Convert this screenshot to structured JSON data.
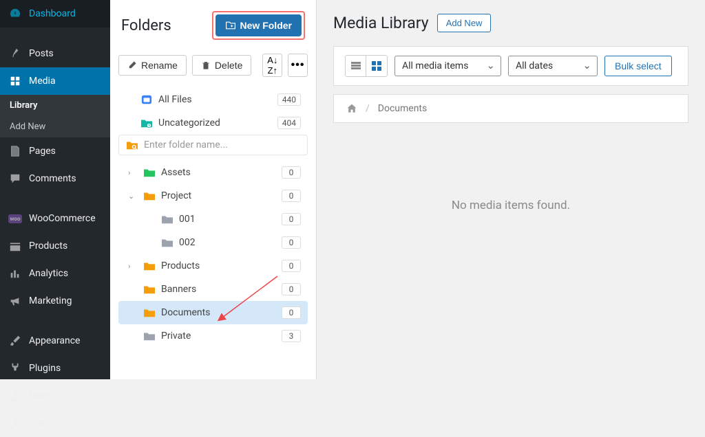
{
  "sidebar": {
    "items": [
      {
        "label": "Dashboard",
        "icon": "gauge"
      },
      {
        "label": "Posts",
        "icon": "pin"
      },
      {
        "label": "Media",
        "icon": "media",
        "active": true,
        "sub": [
          {
            "label": "Library",
            "active": true
          },
          {
            "label": "Add New"
          }
        ]
      },
      {
        "label": "Pages",
        "icon": "page"
      },
      {
        "label": "Comments",
        "icon": "comment"
      },
      {
        "label": "WooCommerce",
        "icon": "woo"
      },
      {
        "label": "Products",
        "icon": "products"
      },
      {
        "label": "Analytics",
        "icon": "chart"
      },
      {
        "label": "Marketing",
        "icon": "megaphone"
      },
      {
        "label": "Appearance",
        "icon": "brush"
      },
      {
        "label": "Plugins",
        "icon": "plug"
      },
      {
        "label": "Users",
        "icon": "users"
      },
      {
        "label": "Tools",
        "icon": "wrench"
      }
    ]
  },
  "folders": {
    "title": "Folders",
    "new_folder_label": "New Folder",
    "rename_label": "Rename",
    "delete_label": "Delete",
    "all_files_label": "All Files",
    "all_files_count": "440",
    "uncategorized_label": "Uncategorized",
    "uncategorized_count": "404",
    "new_folder_placeholder": "Enter folder name...",
    "tree": [
      {
        "name": "Assets",
        "count": "0",
        "color": "#22c55e",
        "expandable": true,
        "indent": 1
      },
      {
        "name": "Project",
        "count": "0",
        "color": "#f59e0b",
        "expanded": true,
        "expandable": true,
        "indent": 1
      },
      {
        "name": "001",
        "count": "0",
        "color": "#9ca3af",
        "indent": 2
      },
      {
        "name": "002",
        "count": "0",
        "color": "#9ca3af",
        "indent": 2
      },
      {
        "name": "Products",
        "count": "0",
        "color": "#f59e0b",
        "expandable": true,
        "indent": 1
      },
      {
        "name": "Banners",
        "count": "0",
        "color": "#f59e0b",
        "indent": 1
      },
      {
        "name": "Documents",
        "count": "0",
        "color": "#f59e0b",
        "selected": true,
        "indent": 1
      },
      {
        "name": "Private",
        "count": "3",
        "color": "#9ca3af",
        "indent": 1
      }
    ]
  },
  "library": {
    "title": "Media Library",
    "add_new_label": "Add New",
    "filter_type": "All media items",
    "filter_date": "All dates",
    "bulk_select_label": "Bulk select",
    "breadcrumb_current": "Documents",
    "empty_message": "No media items found."
  }
}
